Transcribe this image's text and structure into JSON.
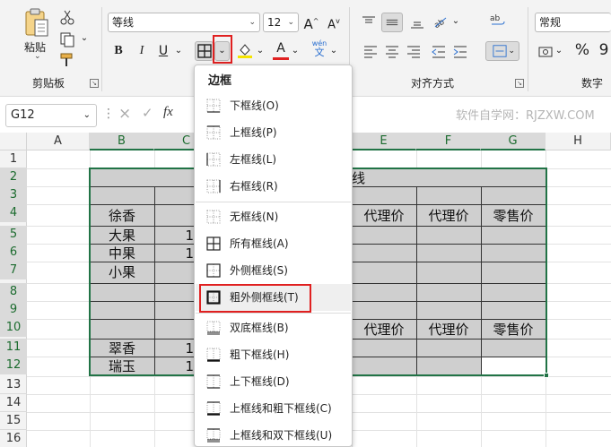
{
  "ribbon": {
    "clipboard": {
      "group_label": "剪贴板",
      "paste_label": "粘贴"
    },
    "font": {
      "font_name": "等线",
      "font_size": "12"
    },
    "alignment": {
      "group_label": "对齐方式"
    },
    "number": {
      "format": "常规",
      "group_label": "数字"
    }
  },
  "namebox": {
    "value": "G12"
  },
  "watermark": "软件自学网：RJZXW.COM",
  "columns": [
    "A",
    "B",
    "C",
    "D",
    "E",
    "F",
    "G",
    "H"
  ],
  "rows": [
    "1",
    "2",
    "3",
    "4",
    "5",
    "6",
    "7",
    "8",
    "9",
    "10",
    "11",
    "12",
    "13",
    "14",
    "15",
    "16"
  ],
  "cells": {
    "d2": "线",
    "b4": "徐香",
    "e4": "代理价",
    "f4": "代理价",
    "g4": "零售价",
    "b5": "大果",
    "c5": "1",
    "b6": "中果",
    "c6": "1",
    "b7": "小果",
    "e10": "代理价",
    "f10": "代理价",
    "g10": "零售价",
    "b11": "翠香",
    "c11": "1",
    "b12": "瑞玉",
    "c12": "1"
  },
  "dropdown": {
    "title": "边框",
    "items": [
      {
        "label": "下框线(O)",
        "icon": "border-bottom-icon"
      },
      {
        "label": "上框线(P)",
        "icon": "border-top-icon"
      },
      {
        "label": "左框线(L)",
        "icon": "border-left-icon"
      },
      {
        "label": "右框线(R)",
        "icon": "border-right-icon"
      },
      {
        "label": "无框线(N)",
        "icon": "border-none-icon"
      },
      {
        "label": "所有框线(A)",
        "icon": "border-all-icon"
      },
      {
        "label": "外侧框线(S)",
        "icon": "border-outside-icon"
      },
      {
        "label": "粗外侧框线(T)",
        "icon": "border-thick-outside-icon"
      },
      {
        "label": "双底框线(B)",
        "icon": "border-double-bottom-icon"
      },
      {
        "label": "粗下框线(H)",
        "icon": "border-thick-bottom-icon"
      },
      {
        "label": "上下框线(D)",
        "icon": "border-top-bottom-icon"
      },
      {
        "label": "上框线和粗下框线(C)",
        "icon": "border-top-thick-bottom-icon"
      },
      {
        "label": "上框线和双下框线(U)",
        "icon": "border-top-double-bottom-icon"
      }
    ],
    "highlighted_index": 7
  },
  "colors": {
    "accent": "#217346",
    "highlight_box": "#e02020",
    "cell_fill": "#cfcfcf"
  }
}
